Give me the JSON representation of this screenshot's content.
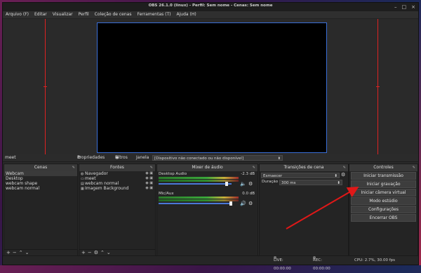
{
  "window": {
    "title": "OBS 26.1.0 (linux) - Perfil: Sem nome - Cenas: Sem nome",
    "controls": [
      "–",
      "□",
      "×"
    ]
  },
  "menu": [
    "Arquivo (F)",
    "Editar",
    "Visualizar",
    "Perfil",
    "Coleção de cenas",
    "Ferramentas (T)",
    "Ajuda (H)"
  ],
  "source_bar": {
    "source_name": "meet",
    "properties_label": "Propriedades",
    "filters_label": "Filtros",
    "window_label": "Janela",
    "window_value": "[Dispositivo não conectado ou não disponível]"
  },
  "scenes": {
    "title": "Cenas",
    "items": [
      "Webcam",
      "Desktop",
      "webcam shape",
      "webcam normal"
    ],
    "selected": "Webcam"
  },
  "sources": {
    "title": "Fontes",
    "items": [
      {
        "name": "Navegador",
        "icon": "browser-icon"
      },
      {
        "name": "meet",
        "icon": "window-icon"
      },
      {
        "name": "webcam normal",
        "icon": "camera-icon"
      },
      {
        "name": "Imagem Background",
        "icon": "image-icon"
      }
    ]
  },
  "mixer": {
    "title": "Mixer de áudio",
    "channels": [
      {
        "name": "Desktop Audio",
        "level": "-2.3 dB",
        "volume": 0.92
      },
      {
        "name": "Mic/Aux",
        "level": "0.0 dB",
        "volume": 0.98
      }
    ]
  },
  "transitions": {
    "title": "Transições de cena",
    "type": "Esmaecer",
    "duration_label": "Duração",
    "duration_value": "300 ms"
  },
  "controls": {
    "title": "Controles",
    "buttons": [
      "Iniciar transmissão",
      "Iniciar gravação",
      "Iniciar câmera virtual",
      "Modo estúdio",
      "Configurações",
      "Encerrar OBS"
    ]
  },
  "status": {
    "live": "LIVE: 00:00:00",
    "rec": "REC: 00:00:00",
    "cpu": "CPU: 2.7%, 30.00 fps"
  },
  "colors": {
    "accent": "#3a6fd8",
    "guide": "#dd2222",
    "annotation_arrow": "#e01818"
  }
}
